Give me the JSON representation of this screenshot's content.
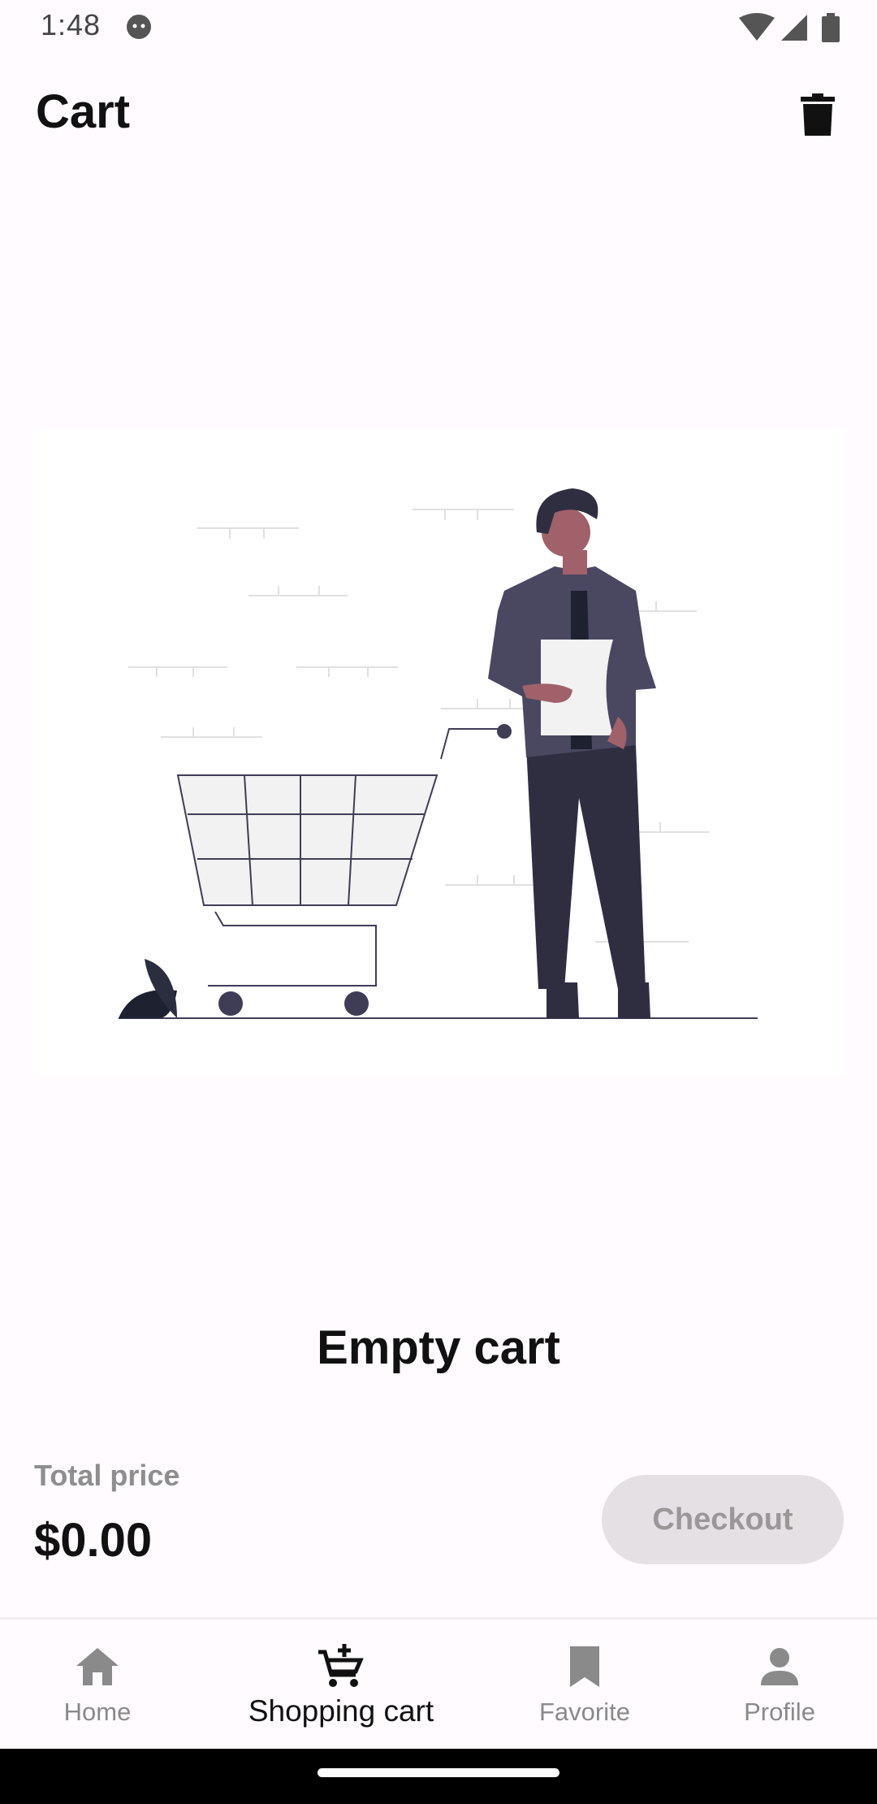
{
  "status_bar": {
    "time": "1:48",
    "icons": [
      "face-icon",
      "wifi-icon",
      "signal-icon",
      "battery-icon"
    ]
  },
  "app_bar": {
    "title": "Cart",
    "action_icon": "trash-icon"
  },
  "illustration": {
    "icon": "empty-cart-illustration"
  },
  "empty_state": {
    "title": "Empty cart"
  },
  "summary": {
    "total_label": "Total price",
    "total_value": "$0.00",
    "checkout_label": "Checkout"
  },
  "bottom_nav": {
    "items": [
      {
        "label": "Home",
        "icon": "home-icon",
        "active": false
      },
      {
        "label": "Shopping cart",
        "icon": "cart-add-icon",
        "active": true
      },
      {
        "label": "Favorite",
        "icon": "bookmark-icon",
        "active": false
      },
      {
        "label": "Profile",
        "icon": "person-icon",
        "active": false
      }
    ]
  },
  "colors": {
    "background": "#fffbfe",
    "figure_shirt": "#4a4760",
    "figure_pants": "#2f2e41",
    "skin": "#a0616a",
    "checkout_disabled_bg": "#e4e0e4"
  }
}
